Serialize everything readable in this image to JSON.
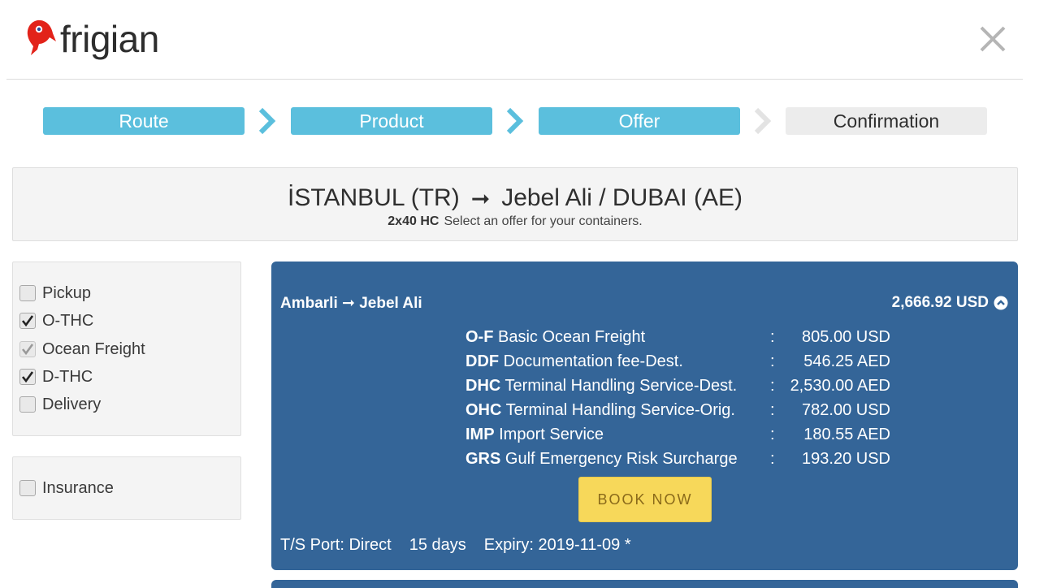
{
  "header": {
    "logo_text": "frigian",
    "close_icon": "close-icon"
  },
  "stepper": {
    "steps": [
      {
        "label": "Route",
        "state": "done"
      },
      {
        "label": "Product",
        "state": "done"
      },
      {
        "label": "Offer",
        "state": "active"
      },
      {
        "label": "Confirmation",
        "state": "pending"
      }
    ]
  },
  "route": {
    "origin": "İSTANBUL (TR)",
    "arrow": "➞",
    "destination": "Jebel Ali / DUBAI (AE)",
    "containers": "2x40 HC",
    "instruction": "Select an offer for your containers."
  },
  "filters": {
    "services": [
      {
        "label": "Pickup",
        "checked": false,
        "disabled": false
      },
      {
        "label": "O-THC",
        "checked": true,
        "disabled": false
      },
      {
        "label": "Ocean Freight",
        "checked": true,
        "disabled": true
      },
      {
        "label": "D-THC",
        "checked": true,
        "disabled": false
      },
      {
        "label": "Delivery",
        "checked": false,
        "disabled": false
      }
    ],
    "extras": [
      {
        "label": "Insurance",
        "checked": false,
        "disabled": false
      }
    ]
  },
  "offer": {
    "route": "Ambarli ➞ Jebel Ali",
    "total": "2,666.92 USD",
    "charges": [
      {
        "code": "O-F",
        "desc": "Basic Ocean Freight",
        "colon": ":",
        "amount": "805.00 USD"
      },
      {
        "code": "DDF",
        "desc": "Documentation fee-Dest.",
        "colon": ":",
        "amount": "546.25 AED"
      },
      {
        "code": "DHC",
        "desc": "Terminal Handling Service-Dest.",
        "colon": ":",
        "amount": "2,530.00 AED"
      },
      {
        "code": "OHC",
        "desc": "Terminal Handling Service-Orig.",
        "colon": ":",
        "amount": "782.00 USD"
      },
      {
        "code": "IMP",
        "desc": "Import Service",
        "colon": ":",
        "amount": "180.55 AED"
      },
      {
        "code": "GRS",
        "desc": "Gulf Emergency Risk Surcharge",
        "colon": ":",
        "amount": "193.20 USD"
      }
    ],
    "book_label": "BOOK NOW",
    "ts_port": "T/S Port: Direct",
    "transit": "15 days",
    "expiry": "Expiry: 2019-11-09 *"
  },
  "colors": {
    "accent": "#5bbfdd",
    "card": "#346598",
    "book_button": "#f7d85a",
    "logo_red": "#e2231a"
  }
}
